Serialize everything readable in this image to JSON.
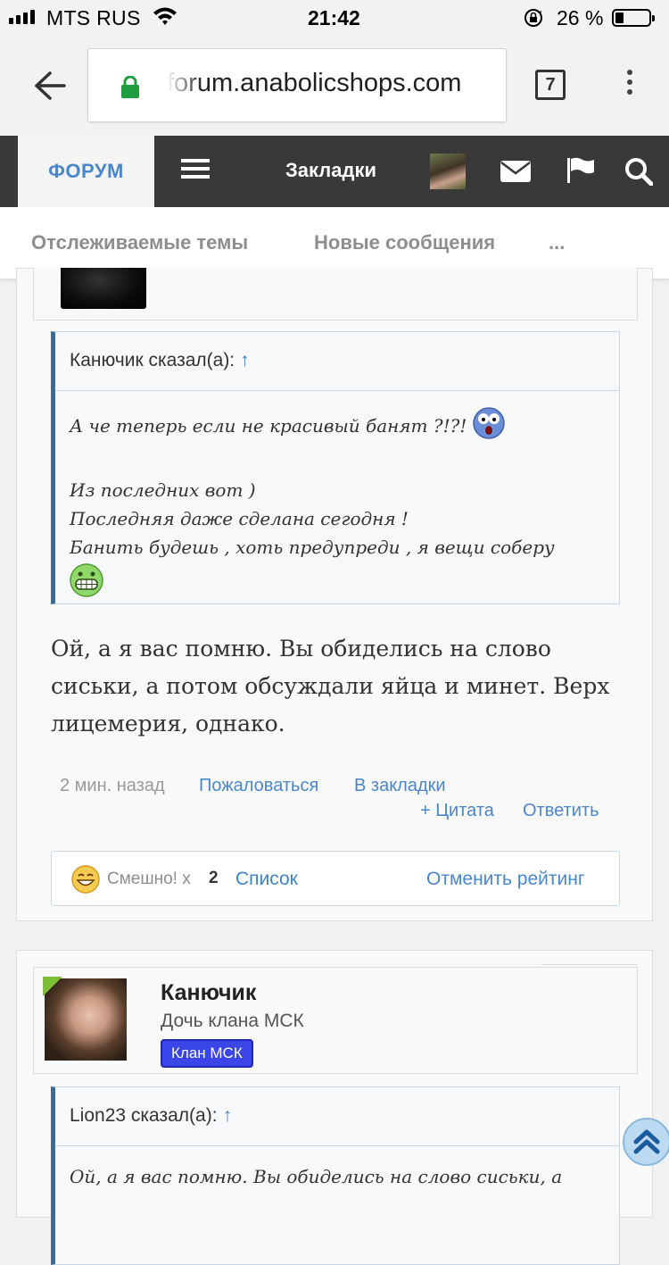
{
  "status_bar": {
    "carrier": "MTS RUS",
    "time": "21:42",
    "battery_percent": "26 %",
    "battery_level": 0.26
  },
  "browser": {
    "url": "forum.anabolicshops.com",
    "tab_count": "7"
  },
  "nav": {
    "forum_tab": "ФОРУМ",
    "bookmarks": "Закладки"
  },
  "subnav": {
    "items": [
      "Отслеживаемые темы",
      "Новые сообщения",
      "..."
    ]
  },
  "post1": {
    "quote_header": "Канючик сказал(а):",
    "quote_arrow": "↑",
    "quote_lines": [
      "А че теперь если не красивый банят ?!?!",
      "Из последних вот )",
      "Последняя даже сделана сегодня !",
      "Банить будешь , хоть предупреди , я вещи соберу"
    ],
    "message": "Ой, а я вас помню. Вы обиделись на слово сиськи, а потом обсуждали яйца и минет. Верх лицемерия, однако.",
    "time_ago": "2 мин. назад",
    "report": "Пожаловаться",
    "bookmark": "В закладки",
    "quote_action": "+ Цитата",
    "reply": "Ответить",
    "rating": {
      "label": "Смешно!",
      "times": "x",
      "count": "2",
      "list": "Список",
      "cancel": "Отменить рейтинг"
    }
  },
  "post2": {
    "username": "Канючик",
    "user_title": "Дочь клана МСК",
    "badge": "Клан МСК",
    "quote_header": "Lion23 сказал(а):",
    "quote_arrow": "↑",
    "quote_line": "Ой, а я вас помню. Вы обиделись на слово сиськи, а"
  },
  "colors": {
    "link": "#4a87c9",
    "nav_bg": "#393939",
    "quote_border": "#3f6a92",
    "badge": "#3b46e8",
    "online": "#7cbf37"
  }
}
